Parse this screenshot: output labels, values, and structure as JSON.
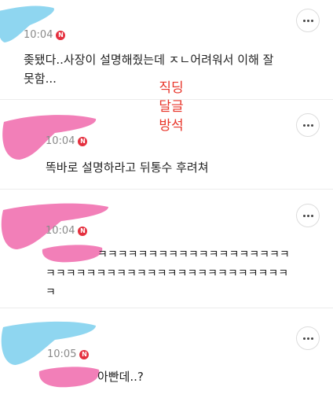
{
  "comments": [
    {
      "time": "10:04",
      "badge": "N",
      "text": "좆됐다..사장이 설명해줬는데 ㅈㄴ어려워서 이해 잘\n못함..."
    },
    {
      "time": "10:04",
      "badge": "N",
      "text": "똑바로 설명하라고 뒤통수 후려쳐"
    },
    {
      "time": "10:04",
      "badge": "N",
      "text": "ㅋㅋㅋㅋㅋㅋㅋㅋㅋㅋㅋㅋㅋㅋㅋㅋㅋㅋㅋ\nㅋㅋㅋㅋㅋㅋㅋㅋㅋㅋㅋㅋㅋㅋㅋㅋㅋㅋㅋㅋㅋㅋㅋㅋ\nㅋ"
    },
    {
      "time": "10:05",
      "badge": "N",
      "text": "아빤데..?"
    }
  ],
  "overlay_text": "직딩\n달글\n방석",
  "more_icon": "ellipsis-icon",
  "colors": {
    "badge": "#e5303f",
    "overlay": "#e8362b",
    "blob_blue": "#8fd6f0",
    "blob_pink": "#f27fb8"
  }
}
